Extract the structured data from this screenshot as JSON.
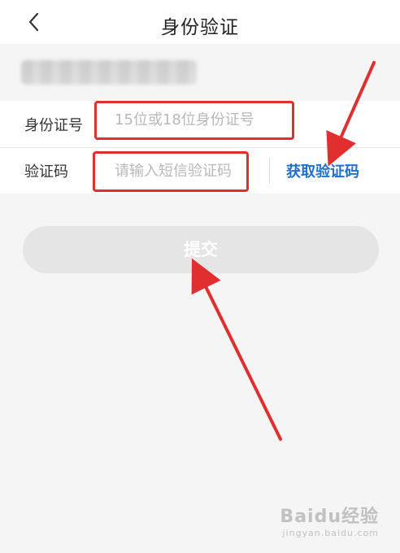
{
  "header": {
    "title": "身份验证",
    "back_icon": "chevron-left-icon"
  },
  "form": {
    "id_row": {
      "label": "身份证号",
      "placeholder": "15位或18位身份证号",
      "value": ""
    },
    "code_row": {
      "label": "验证码",
      "placeholder": "请输入短信验证码",
      "value": "",
      "get_code_label": "获取验证码"
    }
  },
  "actions": {
    "submit_label": "提交"
  },
  "colors": {
    "accent": "#1f6fce",
    "annotation_red": "#e12f2f",
    "background": "#f5f5f5"
  },
  "watermark": {
    "main": "Baidu经验",
    "sub": "jingyan.baidu.com"
  }
}
